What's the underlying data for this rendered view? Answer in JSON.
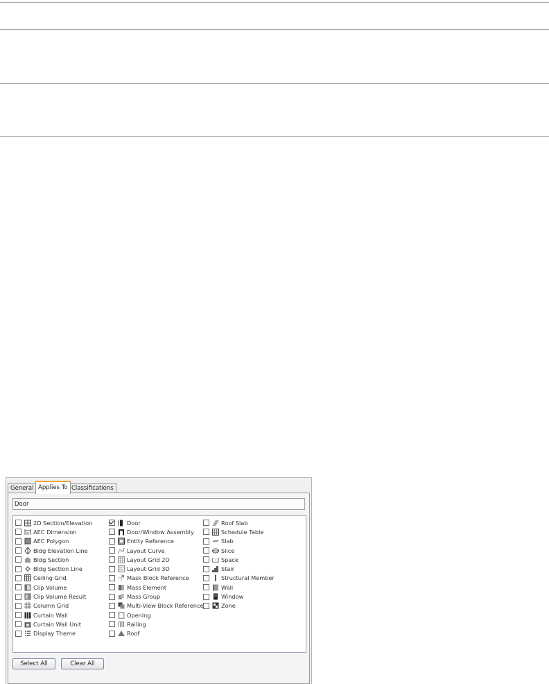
{
  "dialog": {
    "tabs": [
      {
        "label": "General"
      },
      {
        "label": "Applies To"
      },
      {
        "label": "Classifications"
      }
    ],
    "active_tab": 1,
    "name_field": {
      "value": "Door"
    },
    "columns": [
      [
        {
          "label": "2D Section/Elevation",
          "icon": "section-elevation-icon",
          "checked": false
        },
        {
          "label": "AEC Dimension",
          "icon": "dimension-icon",
          "checked": false
        },
        {
          "label": "AEC Polygon",
          "icon": "polygon-icon",
          "checked": false
        },
        {
          "label": "Bldg Elevation Line",
          "icon": "elevation-line-icon",
          "checked": false
        },
        {
          "label": "Bldg Section",
          "icon": "bldg-section-icon",
          "checked": false
        },
        {
          "label": "Bldg Section Line",
          "icon": "section-line-icon",
          "checked": false
        },
        {
          "label": "Ceiling Grid",
          "icon": "ceiling-grid-icon",
          "checked": false
        },
        {
          "label": "Clip Volume",
          "icon": "clip-volume-icon",
          "checked": false
        },
        {
          "label": "Clip Volume Result",
          "icon": "clip-volume-result-icon",
          "checked": false
        },
        {
          "label": "Column Grid",
          "icon": "column-grid-icon",
          "checked": false
        },
        {
          "label": "Curtain Wall",
          "icon": "curtain-wall-icon",
          "checked": false
        },
        {
          "label": "Curtain Wall Unit",
          "icon": "curtain-wall-unit-icon",
          "checked": false
        },
        {
          "label": "Display Theme",
          "icon": "display-theme-icon",
          "checked": false
        }
      ],
      [
        {
          "label": "Door",
          "icon": "door-icon",
          "checked": true
        },
        {
          "label": "Door/Window Assembly",
          "icon": "door-window-assembly-icon",
          "checked": false
        },
        {
          "label": "Entity Reference",
          "icon": "entity-reference-icon",
          "checked": false
        },
        {
          "label": "Layout Curve",
          "icon": "layout-curve-icon",
          "checked": false
        },
        {
          "label": "Layout Grid 2D",
          "icon": "layout-grid-2d-icon",
          "checked": false
        },
        {
          "label": "Layout Grid 3D",
          "icon": "layout-grid-3d-icon",
          "checked": false
        },
        {
          "label": "Mask Block Reference",
          "icon": "mask-block-icon",
          "checked": false
        },
        {
          "label": "Mass Element",
          "icon": "mass-element-icon",
          "checked": false
        },
        {
          "label": "Mass Group",
          "icon": "mass-group-icon",
          "checked": false
        },
        {
          "label": "Multi-View Block Reference",
          "icon": "multi-view-block-icon",
          "checked": false
        },
        {
          "label": "Opening",
          "icon": "opening-icon",
          "checked": false
        },
        {
          "label": "Railing",
          "icon": "railing-icon",
          "checked": false
        },
        {
          "label": "Roof",
          "icon": "roof-icon",
          "checked": false
        }
      ],
      [
        {
          "label": "Roof Slab",
          "icon": "roof-slab-icon",
          "checked": false
        },
        {
          "label": "Schedule Table",
          "icon": "schedule-table-icon",
          "checked": false
        },
        {
          "label": "Slab",
          "icon": "slab-icon",
          "checked": false
        },
        {
          "label": "Slice",
          "icon": "slice-icon",
          "checked": false
        },
        {
          "label": "Space",
          "icon": "space-icon",
          "checked": false
        },
        {
          "label": "Stair",
          "icon": "stair-icon",
          "checked": false
        },
        {
          "label": "Structural Member",
          "icon": "structural-member-icon",
          "checked": false
        },
        {
          "label": "Wall",
          "icon": "wall-icon",
          "checked": false
        },
        {
          "label": "Window",
          "icon": "window-icon",
          "checked": false
        },
        {
          "label": "Zone",
          "icon": "zone-icon",
          "checked": false
        }
      ]
    ],
    "buttons": {
      "select_all": "Select All",
      "clear_all": "Clear All"
    }
  }
}
